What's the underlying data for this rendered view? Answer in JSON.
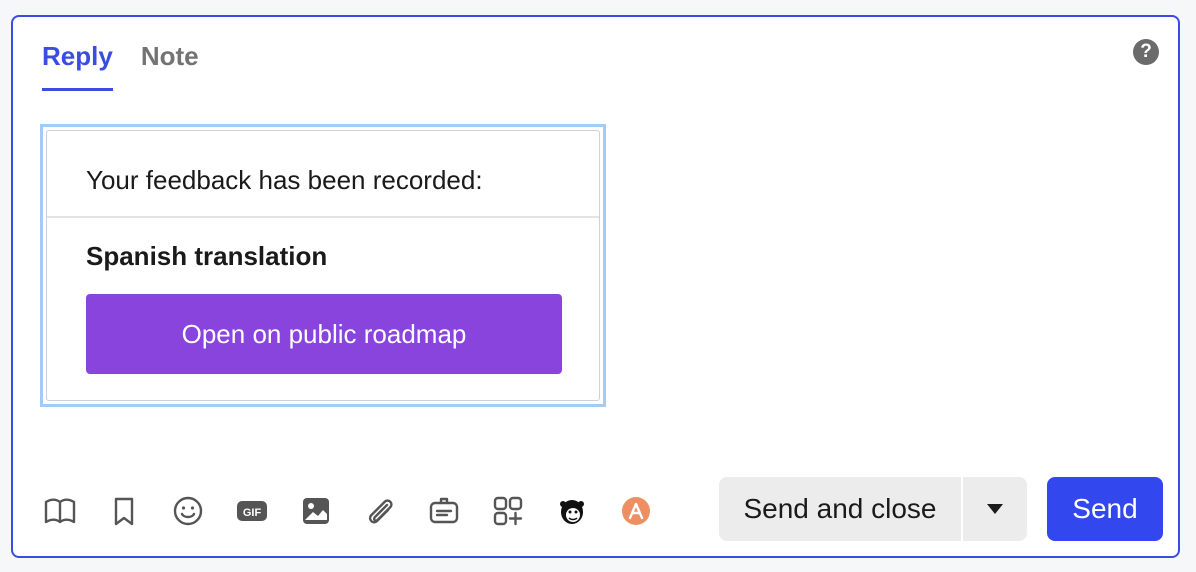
{
  "tabs": {
    "reply": "Reply",
    "note": "Note"
  },
  "help": {
    "glyph": "?"
  },
  "card": {
    "message": "Your feedback has been recorded:",
    "item_title": "Spanish translation",
    "button_label": "Open on public roadmap"
  },
  "toolbar": {
    "icons": [
      "book-icon",
      "bookmark-icon",
      "emoji-icon",
      "gif-icon",
      "image-icon",
      "attachment-icon",
      "ticket-icon",
      "apps-icon",
      "mailchimp-icon",
      "app-integration-icon"
    ],
    "gif_text": "GIF"
  },
  "actions": {
    "send_and_close": "Send and close",
    "send": "Send"
  },
  "colors": {
    "accent": "#3b4de0",
    "send_button": "#3347ee",
    "card_button": "#8844dd",
    "card_outline": "#9fcdf7"
  }
}
